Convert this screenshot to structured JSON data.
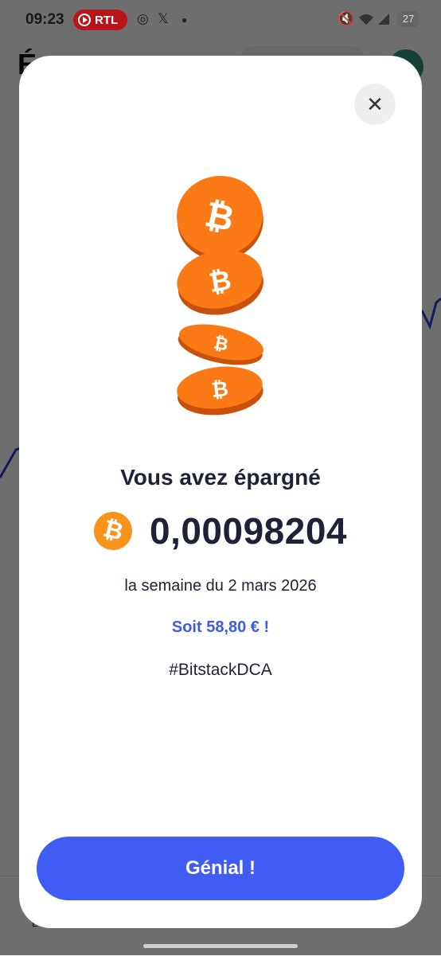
{
  "status_bar": {
    "time": "09:23",
    "badge_label": "RTL",
    "battery": "27"
  },
  "background": {
    "title_letter": "É",
    "bottom_letter": "L"
  },
  "modal": {
    "close_label": "✕",
    "headline": "Vous avez épargné",
    "currency_symbol": "₿",
    "amount": "0,00098204",
    "period": "la semaine du 2 mars 2026",
    "equivalent": "Soit 58,80 € !",
    "hashtag": "#BitstackDCA",
    "cta_label": "Génial !"
  },
  "colors": {
    "accent": "#3f5cf5",
    "bitcoin": "#f7931a",
    "text": "#1e2235",
    "equivalent_text": "#3d5ae8",
    "badge": "#b8151b"
  }
}
